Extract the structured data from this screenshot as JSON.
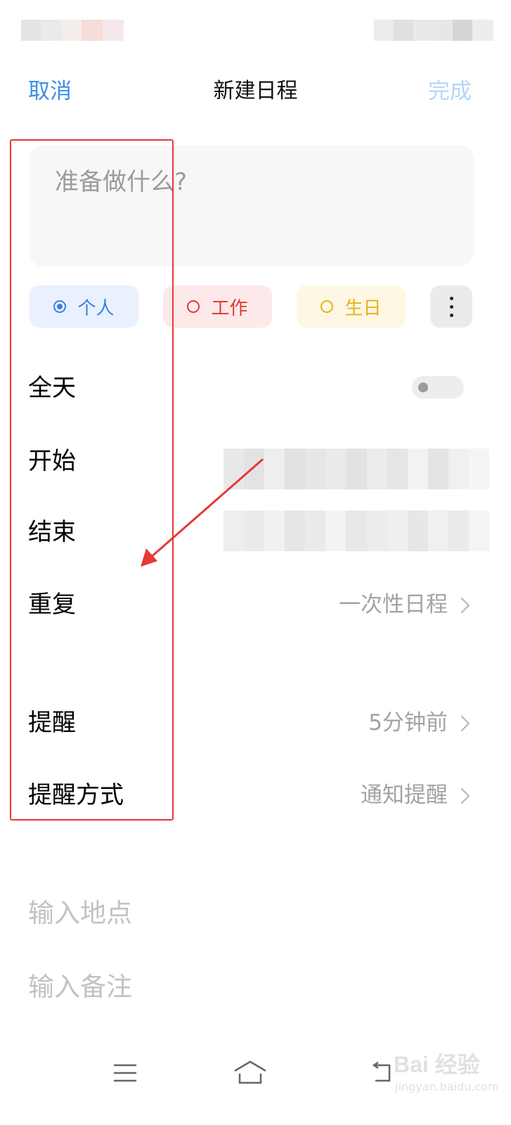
{
  "nav": {
    "cancel_label": "取消",
    "title": "新建日程",
    "done_label": "完成"
  },
  "event_title": {
    "placeholder": "准备做什么?"
  },
  "categories": [
    {
      "label": "个人",
      "selected": true,
      "color": "#3d7fe0"
    },
    {
      "label": "工作",
      "selected": false,
      "color": "#e53935"
    },
    {
      "label": "生日",
      "selected": false,
      "color": "#e8b21d"
    }
  ],
  "rows": {
    "all_day": {
      "label": "全天",
      "toggle_on": false
    },
    "start": {
      "label": "开始"
    },
    "end": {
      "label": "结束"
    },
    "repeat": {
      "label": "重复",
      "value": "一次性日程"
    },
    "reminder": {
      "label": "提醒",
      "value": "5分钟前"
    },
    "reminder_method": {
      "label": "提醒方式",
      "value": "通知提醒"
    }
  },
  "fields": {
    "location_placeholder": "输入地点",
    "notes_placeholder": "输入备注"
  },
  "bottom_nav": [
    "menu-icon",
    "home-icon",
    "back-icon"
  ],
  "watermark": {
    "main": "Bai 经验",
    "sub": "jingyan.baidu.com"
  },
  "colors": {
    "accent": "#3d8fe8",
    "annotation": "#e53935"
  }
}
